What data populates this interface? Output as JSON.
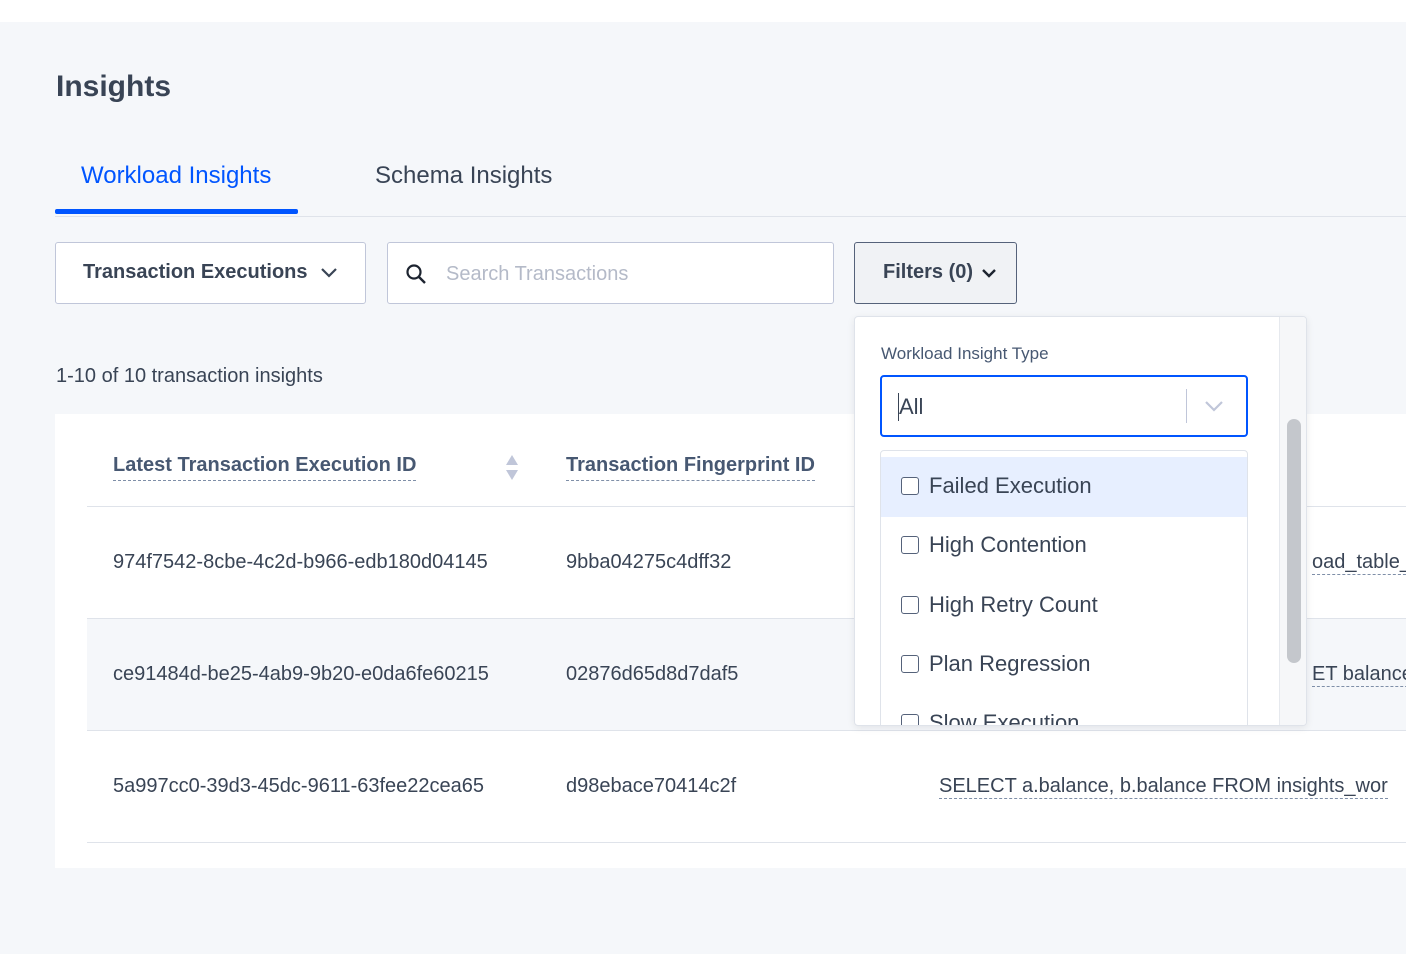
{
  "page": {
    "title": "Insights"
  },
  "tabs": [
    {
      "label": "Workload Insights",
      "active": true
    },
    {
      "label": "Schema Insights",
      "active": false
    }
  ],
  "toolbar": {
    "view_select": "Transaction Executions",
    "search_placeholder": "Search Transactions",
    "filters_label": "Filters (0)"
  },
  "result_count": "1-10 of 10 transaction insights",
  "table": {
    "columns": [
      "Latest Transaction Execution ID",
      "Transaction Fingerprint ID"
    ],
    "rows": [
      {
        "exec_id": "974f7542-8cbe-4c2d-b966-edb180d04145",
        "fingerprint": "9bba04275c4dff32",
        "query": "oad_table_"
      },
      {
        "exec_id": "ce91484d-be25-4ab9-9b20-e0da6fe60215",
        "fingerprint": "02876d65d8d7daf5",
        "query": "ET balance"
      },
      {
        "exec_id": "5a997cc0-39d3-45dc-9611-63fee22cea65",
        "fingerprint": "d98ebace70414c2f",
        "query": "SELECT a.balance, b.balance FROM insights_wor"
      }
    ]
  },
  "filter_panel": {
    "label": "Workload Insight Type",
    "selected": "All",
    "options": [
      "Failed Execution",
      "High Contention",
      "High Retry Count",
      "Plan Regression",
      "Slow Execution"
    ]
  },
  "colors": {
    "accent": "#0055ff",
    "text": "#394455",
    "highlight": "#e7efff"
  }
}
